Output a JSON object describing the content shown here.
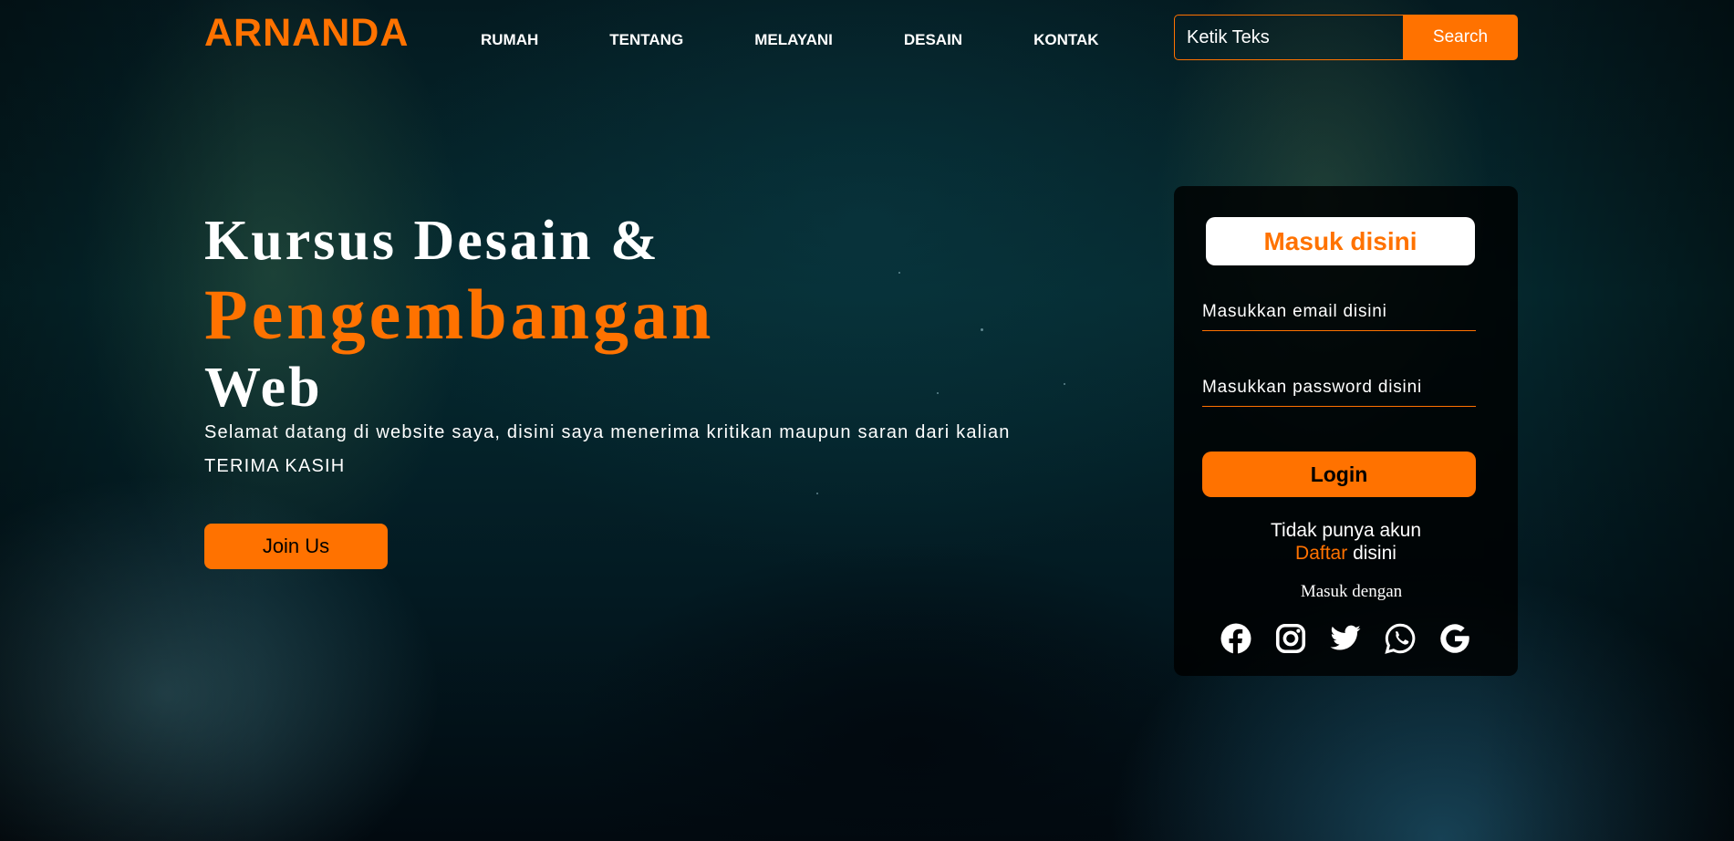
{
  "brand": {
    "name": "ARNANDA",
    "accent": "#ff7200"
  },
  "nav": {
    "items": [
      "RUMAH",
      "TENTANG",
      "MELAYANI",
      "DESAIN",
      "KONTAK"
    ]
  },
  "search": {
    "placeholder": "Ketik Teks",
    "button_label": "Search"
  },
  "hero": {
    "line1": "Kursus Desain &",
    "line2": "Pengembangan",
    "line3": "Web",
    "paragraph": "Selamat datang di website saya, disini saya menerima kritikan maupun saran dari kalian",
    "thanks": "TERIMA KASIH",
    "join_label": "Join Us"
  },
  "login_card": {
    "title": "Masuk disini",
    "email_placeholder": "Masukkan email disini",
    "password_placeholder": "Masukkan password disini",
    "login_label": "Login",
    "no_account": "Tidak punya akun",
    "register_link": "Daftar",
    "register_suffix": " disini",
    "login_with": "Masuk dengan",
    "social_icons": [
      "facebook-icon",
      "instagram-icon",
      "twitter-icon",
      "whatsapp-icon",
      "google-icon"
    ]
  }
}
